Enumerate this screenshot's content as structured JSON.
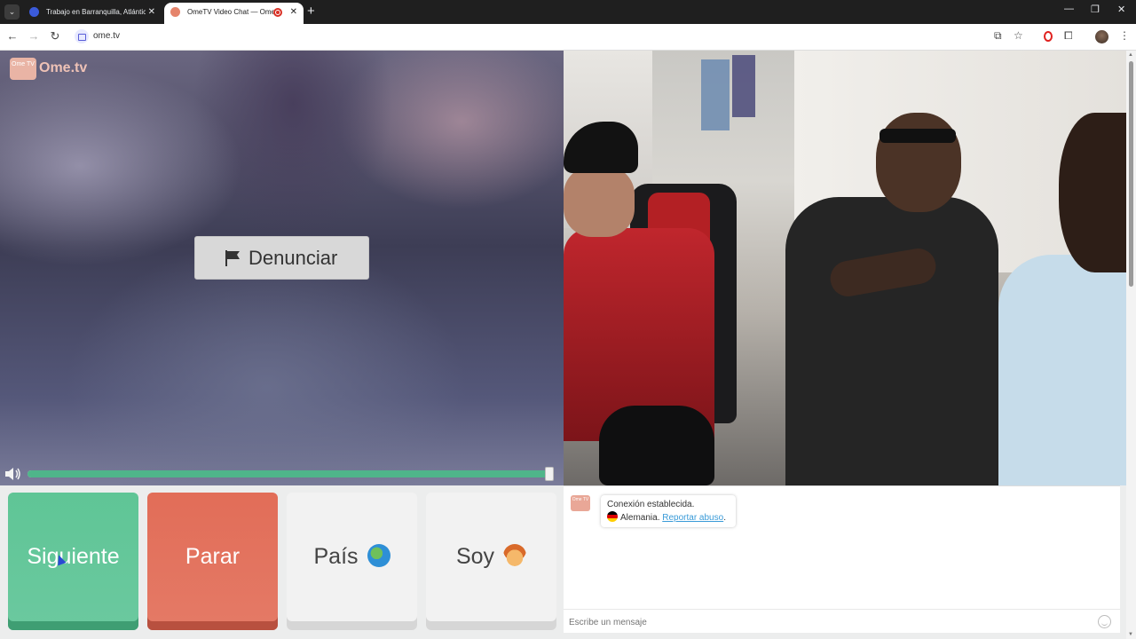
{
  "browser": {
    "tabs": [
      {
        "title": "Trabajo en Barranquilla, Atlántic",
        "active": false,
        "favicon_color": "#3b5bdb"
      },
      {
        "title": "OmeTV Video Chat — Ome",
        "active": true,
        "favicon_color": "#e5846b"
      }
    ],
    "address": {
      "url": "ome.tv"
    }
  },
  "icons": {
    "tab_list": "chevron-down-icon",
    "back": "arrow-left-icon",
    "forward": "arrow-right-icon",
    "reload": "reload-icon",
    "install": "install-app-icon",
    "bookmark": "star-icon",
    "opera": "opera-icon",
    "extensions": "puzzle-icon",
    "menu": "kebab-menu-icon",
    "report": "flag-icon",
    "volume": "speaker-icon",
    "emoji": "smiley-icon"
  },
  "app": {
    "logo": {
      "badge": "Ome TV",
      "wordmark": "Ome.tv"
    },
    "report_button": "Denunciar",
    "volume": {
      "level": 1.0
    }
  },
  "controls": {
    "next": "Siguiente",
    "stop": "Parar",
    "country": "País",
    "gender": "Soy",
    "next_color": "#5fc596",
    "stop_color": "#e26d58"
  },
  "chat": {
    "logo_badge": "Ome TV",
    "status": "Conexión establecida.",
    "country": "Alemania.",
    "report_link": "Reportar abuso",
    "report_period": ".",
    "input_placeholder": "Escribe un mensaje"
  }
}
